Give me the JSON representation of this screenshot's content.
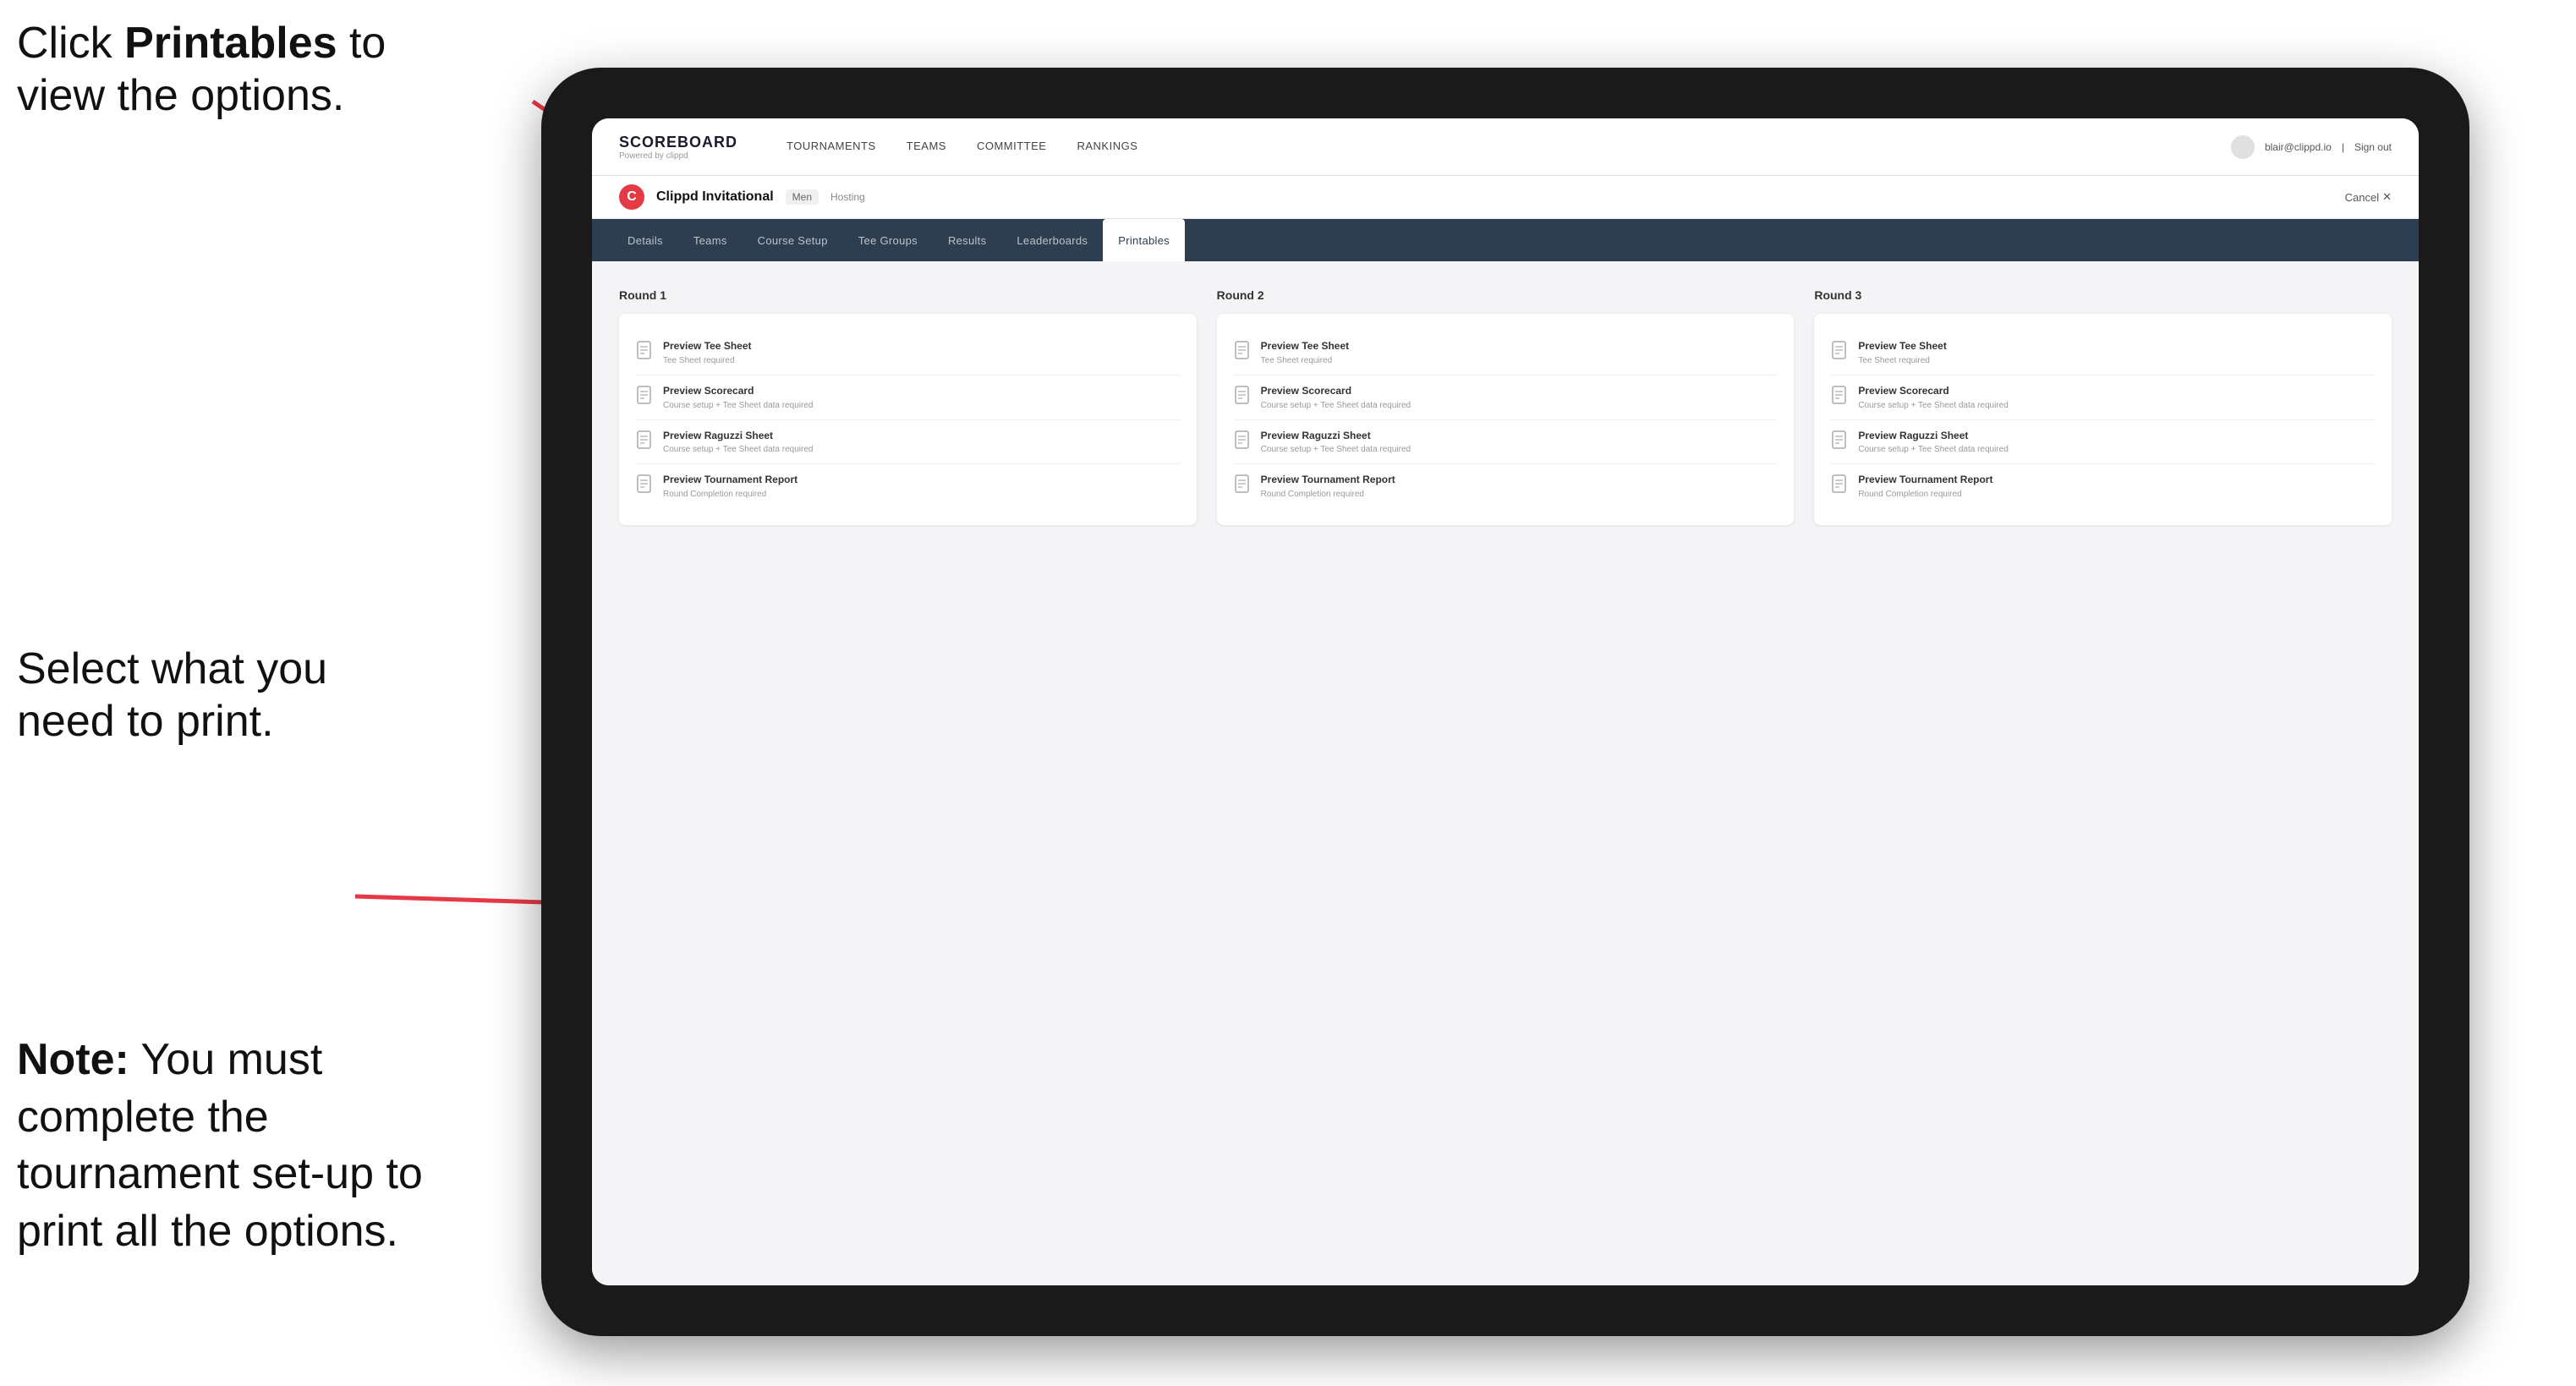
{
  "annotations": {
    "top_text_1": "Click ",
    "top_text_bold": "Printables",
    "top_text_2": " to view the options.",
    "middle_text": "Select what you need to print.",
    "bottom_text_bold": "Note:",
    "bottom_text": " You must complete the tournament set-up to print all the options."
  },
  "nav": {
    "brand_title": "SCOREBOARD",
    "brand_sub": "Powered by clippd",
    "links": [
      {
        "label": "TOURNAMENTS",
        "active": false
      },
      {
        "label": "TEAMS",
        "active": false
      },
      {
        "label": "COMMITTEE",
        "active": false
      },
      {
        "label": "RANKINGS",
        "active": false
      }
    ],
    "user_email": "blair@clippd.io",
    "sign_out": "Sign out"
  },
  "sub_header": {
    "tournament_name": "Clippd Invitational",
    "tournament_tag": "Men",
    "hosting": "Hosting",
    "cancel": "Cancel"
  },
  "tabs": [
    {
      "label": "Details",
      "active": false
    },
    {
      "label": "Teams",
      "active": false
    },
    {
      "label": "Course Setup",
      "active": false
    },
    {
      "label": "Tee Groups",
      "active": false
    },
    {
      "label": "Results",
      "active": false
    },
    {
      "label": "Leaderboards",
      "active": false
    },
    {
      "label": "Printables",
      "active": true
    }
  ],
  "rounds": [
    {
      "title": "Round 1",
      "items": [
        {
          "title": "Preview Tee Sheet",
          "sub": "Tee Sheet required"
        },
        {
          "title": "Preview Scorecard",
          "sub": "Course setup + Tee Sheet data required"
        },
        {
          "title": "Preview Raguzzi Sheet",
          "sub": "Course setup + Tee Sheet data required"
        },
        {
          "title": "Preview Tournament Report",
          "sub": "Round Completion required"
        }
      ]
    },
    {
      "title": "Round 2",
      "items": [
        {
          "title": "Preview Tee Sheet",
          "sub": "Tee Sheet required"
        },
        {
          "title": "Preview Scorecard",
          "sub": "Course setup + Tee Sheet data required"
        },
        {
          "title": "Preview Raguzzi Sheet",
          "sub": "Course setup + Tee Sheet data required"
        },
        {
          "title": "Preview Tournament Report",
          "sub": "Round Completion required"
        }
      ]
    },
    {
      "title": "Round 3",
      "items": [
        {
          "title": "Preview Tee Sheet",
          "sub": "Tee Sheet required"
        },
        {
          "title": "Preview Scorecard",
          "sub": "Course setup + Tee Sheet data required"
        },
        {
          "title": "Preview Raguzzi Sheet",
          "sub": "Course setup + Tee Sheet data required"
        },
        {
          "title": "Preview Tournament Report",
          "sub": "Round Completion required"
        }
      ]
    }
  ]
}
